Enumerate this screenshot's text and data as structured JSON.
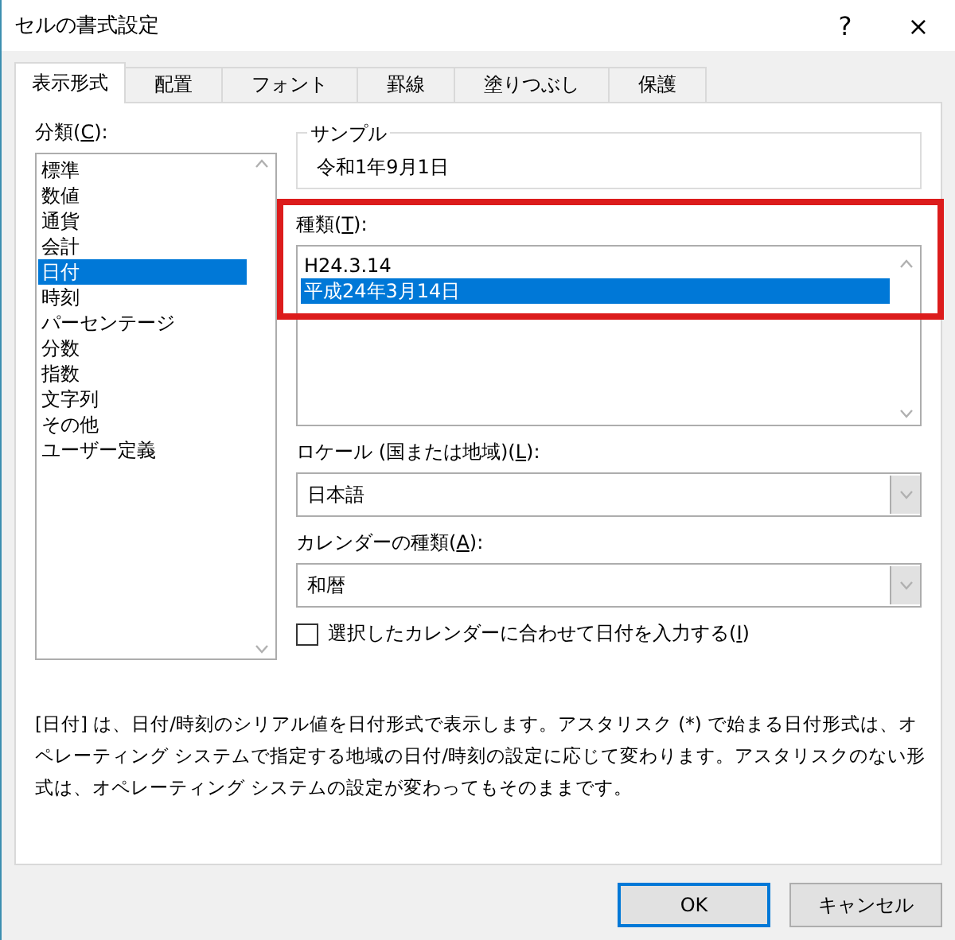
{
  "window": {
    "title": "セルの書式設定",
    "help": "?",
    "close": "×"
  },
  "tabs": [
    {
      "label": "表示形式",
      "selected": true
    },
    {
      "label": "配置",
      "selected": false
    },
    {
      "label": "フォント",
      "selected": false
    },
    {
      "label": "罫線",
      "selected": false
    },
    {
      "label": "塗りつぶし",
      "selected": false
    },
    {
      "label": "保護",
      "selected": false
    }
  ],
  "category": {
    "label": "分類(**C**):",
    "items": [
      {
        "label": "標準",
        "selected": false
      },
      {
        "label": "数値",
        "selected": false
      },
      {
        "label": "通貨",
        "selected": false
      },
      {
        "label": "会計",
        "selected": false
      },
      {
        "label": "日付",
        "selected": true
      },
      {
        "label": "時刻",
        "selected": false
      },
      {
        "label": "パーセンテージ",
        "selected": false
      },
      {
        "label": "分数",
        "selected": false
      },
      {
        "label": "指数",
        "selected": false
      },
      {
        "label": "文字列",
        "selected": false
      },
      {
        "label": "その他",
        "selected": false
      },
      {
        "label": "ユーザー定義",
        "selected": false
      }
    ]
  },
  "sample": {
    "label": "サンプル",
    "value": "令和1年9月1日"
  },
  "type": {
    "label": "種類(**T**):",
    "items": [
      {
        "label": "H24.3.14",
        "selected": false
      },
      {
        "label": "平成24年3月14日",
        "selected": true
      }
    ]
  },
  "locale": {
    "label": "ロケール (国または地域)(**L**):",
    "value": "日本語"
  },
  "calendar": {
    "label": "カレンダーの種類(**A**):",
    "value": "和暦"
  },
  "match_calendar": {
    "label": "選択したカレンダーに合わせて日付を入力する(**I**)",
    "checked": false
  },
  "description": "[日付] は、日付/時刻のシリアル値を日付形式で表示します。アスタリスク (*) で始まる日付形式は、オペレーティング システムで指定する地域の日付/時刻の設定に応じて変わります。アスタリスクのない形式は、オペレーティング システムの設定が変わってもそのままです。",
  "buttons": [
    {
      "label": "OK",
      "kind": "default"
    },
    {
      "label": "キャンセル",
      "kind": "normal"
    }
  ]
}
